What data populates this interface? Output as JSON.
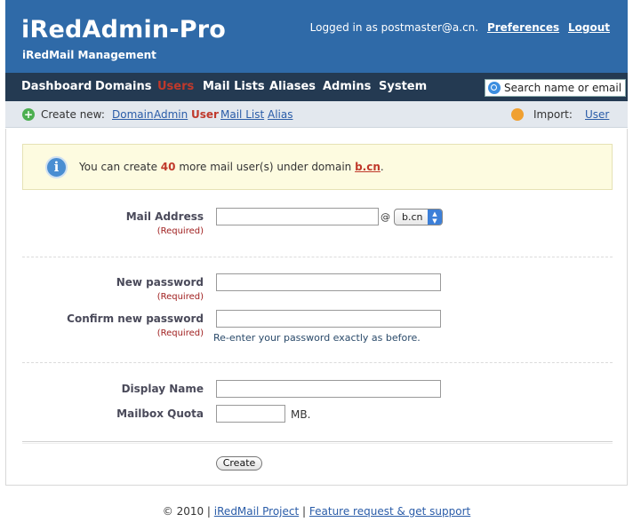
{
  "header": {
    "title": "iRedAdmin-Pro",
    "subtitle": "iRedMail Management",
    "logged_in_text": "Logged in as postmaster@a.cn.",
    "preferences": "Preferences",
    "logout": "Logout"
  },
  "nav": {
    "items": [
      "Dashboard",
      "Domains",
      "Users",
      "Mail Lists",
      "Aliases",
      "Admins",
      "System"
    ],
    "active": "Users",
    "search_placeholder": "Search name or email"
  },
  "subbar": {
    "create_new": "Create new:",
    "links": [
      "Domain",
      "Admin",
      "User",
      "Mail List",
      "Alias"
    ],
    "active": "User",
    "import_label": "Import:",
    "import_link": "User"
  },
  "info": {
    "prefix": "You can create",
    "count": "40",
    "middle": "more mail user(s) under domain",
    "domain": "b.cn",
    "suffix": "."
  },
  "form": {
    "mail_address_label": "Mail Address",
    "required": "(Required)",
    "at_sign": "@",
    "domain_value": "b.cn",
    "new_password_label": "New password",
    "confirm_password_label": "Confirm new password",
    "confirm_hint": "Re-enter your password exactly as before.",
    "display_name_label": "Display Name",
    "mailbox_quota_label": "Mailbox Quota",
    "quota_unit": "MB.",
    "create_button": "Create"
  },
  "footer": {
    "copyright": "© 2010 |",
    "project_link": "iRedMail Project",
    "separator": "|",
    "support_link": "Feature request & get support"
  },
  "colors": {
    "header_bg": "#2f6aa8",
    "nav_bg": "#243a52",
    "active_red": "#c0392b",
    "link_blue": "#2a5ca8"
  }
}
